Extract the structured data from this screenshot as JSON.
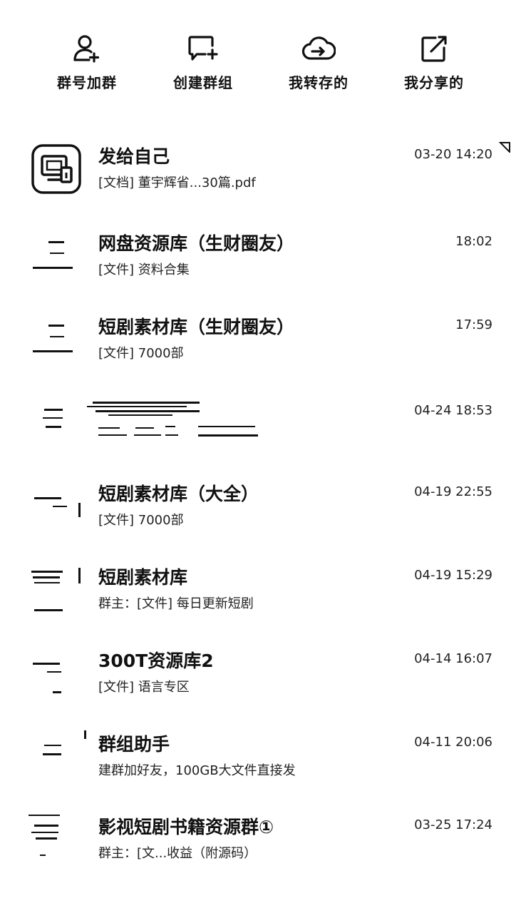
{
  "actions": [
    {
      "label": "群号加群",
      "icon": "add-user-icon"
    },
    {
      "label": "创建群组",
      "icon": "add-chat-icon"
    },
    {
      "label": "我转存的",
      "icon": "cloud-transfer-icon"
    },
    {
      "label": "我分享的",
      "icon": "share-edit-icon"
    }
  ],
  "chats": [
    {
      "title": "发给自己",
      "subtitle": "[文档] 董宇辉省...30篇.pdf",
      "time": "03-20 14:20"
    },
    {
      "title": "网盘资源库（生财圈友）",
      "subtitle": "[文件] 资料合集",
      "time": "18:02"
    },
    {
      "title": "短剧素材库（生财圈友）",
      "subtitle": "[文件] 7000部",
      "time": "17:59"
    },
    {
      "title": "",
      "subtitle": "",
      "time": "04-24 18:53"
    },
    {
      "title": "短剧素材库（大全）",
      "subtitle": "[文件] 7000部",
      "time": "04-19 22:55"
    },
    {
      "title": "短剧素材库",
      "subtitle": "群主：[文件] 每日更新短剧",
      "time": "04-19 15:29"
    },
    {
      "title": "300T资源库2",
      "subtitle": "[文件] 语言专区",
      "time": "04-14 16:07"
    },
    {
      "title": "群组助手",
      "subtitle": "建群加好友，100GB大文件直接发",
      "time": "04-11 20:06"
    },
    {
      "title": "影视短剧书籍资源群①",
      "subtitle": "群主：[文...收益（附源码）",
      "time": "03-25 17:24"
    }
  ]
}
